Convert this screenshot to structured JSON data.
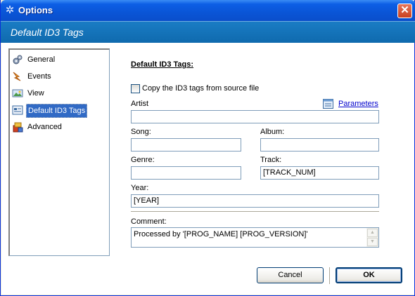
{
  "window": {
    "title": "Options",
    "header": "Default ID3 Tags"
  },
  "nav": {
    "items": [
      {
        "label": "General",
        "icon": "gears-icon"
      },
      {
        "label": "Events",
        "icon": "events-icon"
      },
      {
        "label": "View",
        "icon": "view-icon"
      },
      {
        "label": "Default ID3 Tags",
        "icon": "id3-tags-icon",
        "selected": true
      },
      {
        "label": "Advanced",
        "icon": "advanced-icon"
      }
    ]
  },
  "form": {
    "section_title": "Default ID3 Tags:",
    "copy_checkbox_label": "Copy the ID3 tags from source file",
    "copy_checked": false,
    "parameters_link": "Parameters",
    "artist_label": "Artist",
    "artist_value": "",
    "song_label": "Song:",
    "song_value": "",
    "album_label": "Album:",
    "album_value": "",
    "genre_label": "Genre:",
    "genre_value": "",
    "track_label": "Track:",
    "track_value": "[TRACK_NUM]",
    "year_label": "Year:",
    "year_value": "[YEAR]",
    "comment_label": "Comment:",
    "comment_value": "Processed by '[PROG_NAME] [PROG_VERSION]'"
  },
  "buttons": {
    "cancel": "Cancel",
    "ok": "OK"
  },
  "colors": {
    "header_band": "#1a7cc4",
    "selection": "#316ac5",
    "link": "#0000cc"
  }
}
